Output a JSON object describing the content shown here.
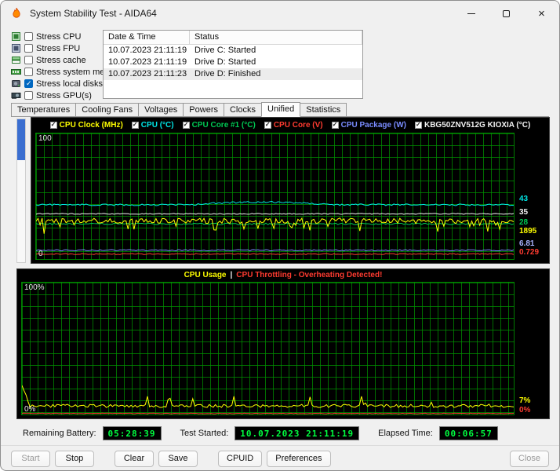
{
  "window": {
    "title": "System Stability Test - AIDA64"
  },
  "stress_options": [
    {
      "label": "Stress CPU",
      "checked": false,
      "icon": "cpu-icon"
    },
    {
      "label": "Stress FPU",
      "checked": false,
      "icon": "fpu-icon"
    },
    {
      "label": "Stress cache",
      "checked": false,
      "icon": "cache-icon"
    },
    {
      "label": "Stress system memory",
      "checked": false,
      "icon": "memory-icon"
    },
    {
      "label": "Stress local disks",
      "checked": true,
      "icon": "disk-icon"
    },
    {
      "label": "Stress GPU(s)",
      "checked": false,
      "icon": "gpu-icon"
    }
  ],
  "log": {
    "columns": [
      "Date & Time",
      "Status"
    ],
    "rows": [
      {
        "date": "10.07.2023 21:11:19",
        "status": "Drive C: Started",
        "selected": false
      },
      {
        "date": "10.07.2023 21:11:19",
        "status": "Drive D: Started",
        "selected": false
      },
      {
        "date": "10.07.2023 21:11:23",
        "status": "Drive D: Finished",
        "selected": true
      }
    ]
  },
  "tabs": [
    {
      "label": "Temperatures",
      "active": false
    },
    {
      "label": "Cooling Fans",
      "active": false
    },
    {
      "label": "Voltages",
      "active": false
    },
    {
      "label": "Powers",
      "active": false
    },
    {
      "label": "Clocks",
      "active": false
    },
    {
      "label": "Unified",
      "active": true
    },
    {
      "label": "Statistics",
      "active": false
    }
  ],
  "chart_data": [
    {
      "type": "line",
      "ylim": [
        0,
        100
      ],
      "grid": true,
      "y_axis_labels": {
        "top": "100",
        "bottom": "0"
      },
      "legend": [
        {
          "label": "CPU Clock (MHz)",
          "color": "#ffff00",
          "checked": true
        },
        {
          "label": "CPU (°C)",
          "color": "#00e5e5",
          "checked": true
        },
        {
          "label": "CPU Core #1 (°C)",
          "color": "#00c853",
          "checked": true
        },
        {
          "label": "CPU Core (V)",
          "color": "#ff3b30",
          "checked": true
        },
        {
          "label": "CPU Package (W)",
          "color": "#7a8cff",
          "checked": true
        },
        {
          "label": "KBG50ZNV512G KIOXIA (°C)",
          "color": "#f2f2f2",
          "checked": true
        }
      ],
      "right_values": [
        {
          "value": "43",
          "color": "#00e5e5"
        },
        {
          "value": "35",
          "color": "#f2f2f2"
        },
        {
          "value": "28",
          "color": "#00c853"
        },
        {
          "value": "1895",
          "color": "#ffff00"
        },
        {
          "value": "6.81",
          "color": "#aab4ff"
        },
        {
          "value": "0.729",
          "color": "#ff3b30"
        }
      ],
      "series": [
        {
          "name": "CPU Package (W)",
          "color": "#7a8cff",
          "baseline": 7,
          "noise": 0.5,
          "seed": 55
        },
        {
          "name": "CPU Core (V)",
          "color": "#ff3b30",
          "baseline": 4,
          "noise": 0.45,
          "seed": 66
        },
        {
          "name": "KBG50ZNV512G KIOXIA (°C)",
          "color": "#f2f2f2",
          "baseline": 36,
          "noise": 0.35,
          "seed": 22
        },
        {
          "name": "CPU Core #1 (°C)",
          "color": "#00c853",
          "baseline": 28,
          "noise": 0.6,
          "seed": 33
        },
        {
          "name": "CPU (°C)",
          "color": "#00e5e5",
          "baseline": 43.2,
          "noise": 0.7,
          "seed": 11,
          "bump": {
            "start": 0.32,
            "end": 0.62,
            "height": 2.2
          }
        },
        {
          "name": "CPU Clock (MHz)",
          "color": "#ffff00",
          "baseline": 30.5,
          "noise": 2.2,
          "seed": 44,
          "spike_prob": 0.16,
          "spike_size": -9
        }
      ]
    },
    {
      "type": "line",
      "ylim": [
        0,
        100
      ],
      "grid": true,
      "y_axis_labels": {
        "top": "100%",
        "bottom": "0%"
      },
      "title_parts": {
        "left": "CPU Usage",
        "left_color": "#ffff00",
        "separator": "|",
        "separator_color": "#f2f2f2",
        "right": "CPU Throttling - Overheating Detected!",
        "right_color": "#ff3b30"
      },
      "right_values": [
        {
          "value": "7%",
          "color": "#ffff00"
        },
        {
          "value": "0%",
          "color": "#ff3b30"
        }
      ],
      "series": [
        {
          "name": "CPU Throttling",
          "color": "#ff3b30",
          "baseline": 0.8,
          "noise": 0.25,
          "seed": 88
        },
        {
          "name": "CPU Usage",
          "color": "#ffff00",
          "baseline": 6.5,
          "noise": 1.2,
          "seed": 77,
          "spike_prob": 0.05,
          "spike_size": 7,
          "initial": 22
        }
      ]
    }
  ],
  "status_bar": {
    "battery_label": "Remaining Battery:",
    "battery_value": "05:28:39",
    "started_label": "Test Started:",
    "started_value": "10.07.2023 21:11:19",
    "elapsed_label": "Elapsed Time:",
    "elapsed_value": "00:06:57"
  },
  "buttons": [
    {
      "label": "Start",
      "enabled": false
    },
    {
      "label": "Stop",
      "enabled": true
    },
    {
      "label": "Clear",
      "enabled": true
    },
    {
      "label": "Save",
      "enabled": true
    },
    {
      "label": "CPUID",
      "enabled": true
    },
    {
      "label": "Preferences",
      "enabled": true
    },
    {
      "label": "Close",
      "enabled": false
    }
  ],
  "colors": {
    "accent": "#0067c0",
    "lcd_text": "#00ff40",
    "grid": "#009100",
    "chart_bg": "#000000"
  }
}
